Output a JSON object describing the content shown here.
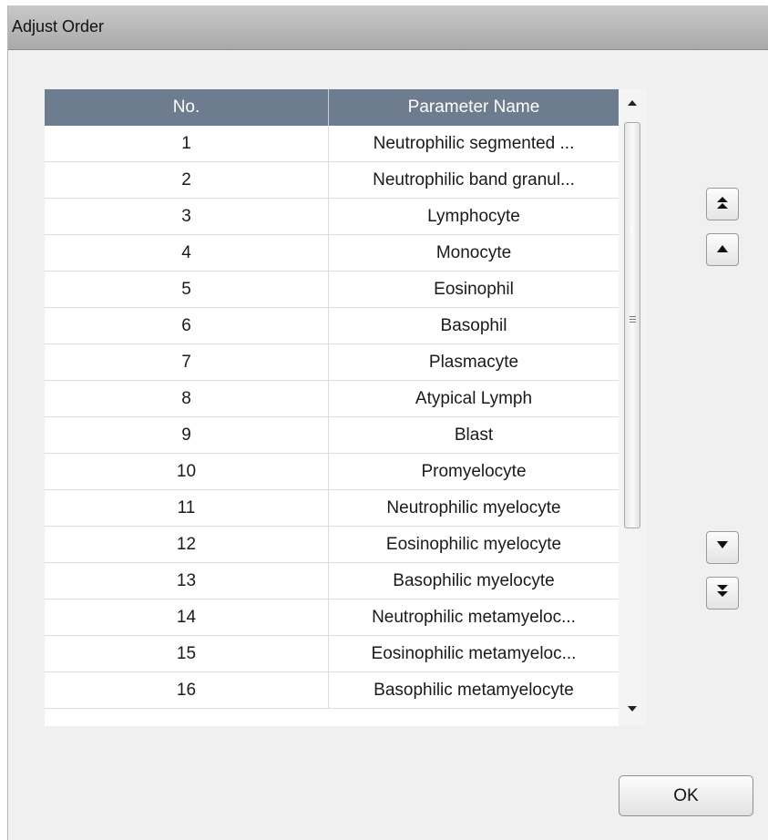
{
  "dialog": {
    "title": "Adjust Order"
  },
  "table": {
    "headers": {
      "no": "No.",
      "name": "Parameter Name"
    },
    "rows": [
      {
        "no": "1",
        "name": "Neutrophilic segmented ..."
      },
      {
        "no": "2",
        "name": "Neutrophilic band granul..."
      },
      {
        "no": "3",
        "name": "Lymphocyte"
      },
      {
        "no": "4",
        "name": "Monocyte"
      },
      {
        "no": "5",
        "name": "Eosinophil"
      },
      {
        "no": "6",
        "name": "Basophil"
      },
      {
        "no": "7",
        "name": "Plasmacyte"
      },
      {
        "no": "8",
        "name": "Atypical Lymph"
      },
      {
        "no": "9",
        "name": "Blast"
      },
      {
        "no": "10",
        "name": "Promyelocyte"
      },
      {
        "no": "11",
        "name": "Neutrophilic myelocyte"
      },
      {
        "no": "12",
        "name": "Eosinophilic myelocyte"
      },
      {
        "no": "13",
        "name": "Basophilic myelocyte"
      },
      {
        "no": "14",
        "name": "Neutrophilic metamyeloc..."
      },
      {
        "no": "15",
        "name": "Eosinophilic metamyeloc..."
      },
      {
        "no": "16",
        "name": "Basophilic metamyelocyte"
      }
    ]
  },
  "actions": {
    "ok_label": "OK",
    "move_top_icon": "double-chevron-up-icon",
    "move_up_icon": "triangle-up-icon",
    "move_down_icon": "triangle-down-icon",
    "move_bottom_icon": "double-chevron-down-icon"
  },
  "colors": {
    "header_bg": "#6d7c8f",
    "title_bar": "#b8b8b8",
    "dialog_bg": "#f0f0f0"
  }
}
